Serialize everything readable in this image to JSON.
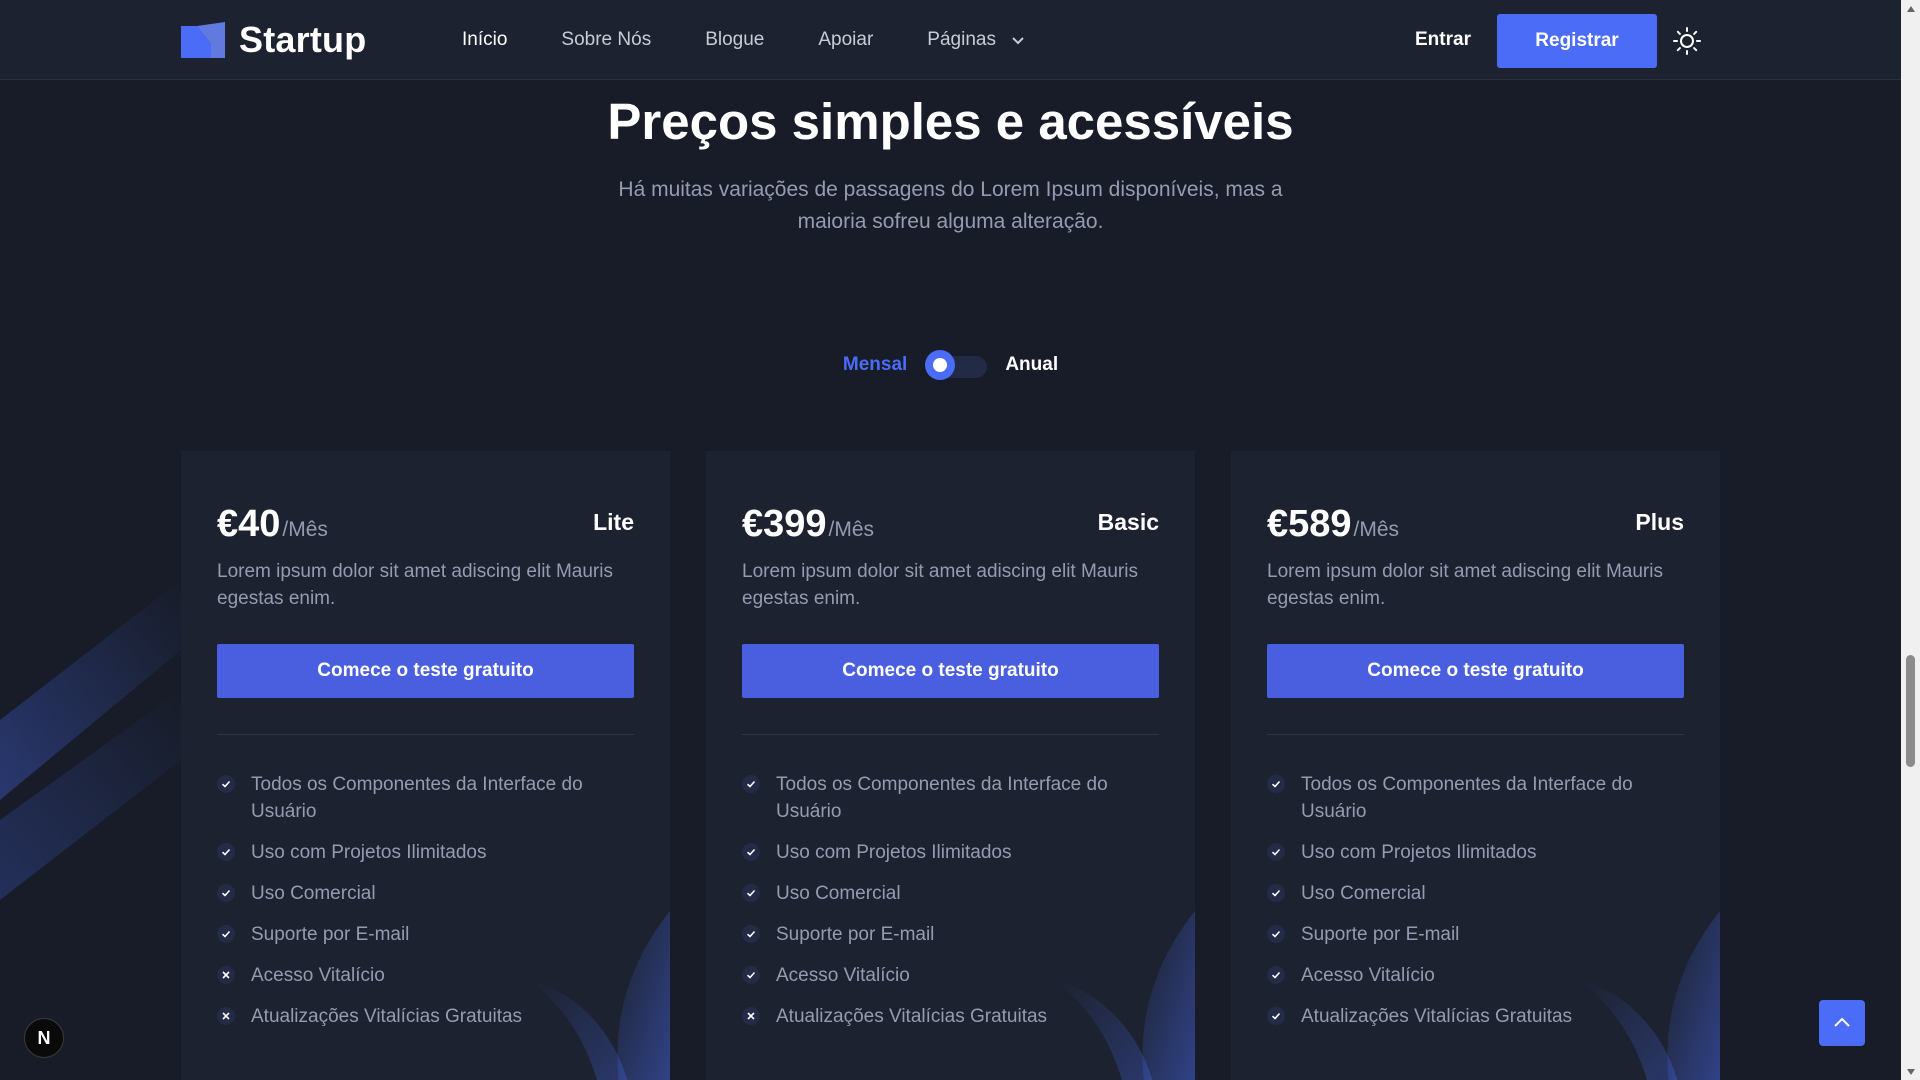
{
  "colors": {
    "accent": "#4a6cf7",
    "background": "#171c28",
    "card": "#1d2230",
    "muted": "#959cb1"
  },
  "header": {
    "logo_text": "Startup",
    "nav": [
      {
        "label": "Início",
        "active": true
      },
      {
        "label": "Sobre Nós"
      },
      {
        "label": "Blogue"
      },
      {
        "label": "Apoiar"
      },
      {
        "label": "Páginas",
        "icon": "chevron-down-icon"
      }
    ],
    "signin_label": "Entrar",
    "register_label": "Registrar",
    "theme_icon": "sun-icon"
  },
  "section": {
    "title": "Preços simples e acessíveis",
    "subtitle": "Há muitas variações de passagens do Lorem Ipsum disponíveis, mas a maioria sofreu alguma alteração."
  },
  "billing": {
    "monthly_label": "Mensal",
    "yearly_label": "Anual",
    "selected": "monthly"
  },
  "plans": [
    {
      "price": "€40",
      "period": "/Mês",
      "name": "Lite",
      "description": "Lorem ipsum dolor sit amet adiscing elit Mauris egestas enim.",
      "cta": "Comece o teste gratuito",
      "features": [
        {
          "text": "Todos os Componentes da Interface do Usuário",
          "included": true
        },
        {
          "text": "Uso com Projetos Ilimitados",
          "included": true
        },
        {
          "text": "Uso Comercial",
          "included": true
        },
        {
          "text": "Suporte por E-mail",
          "included": true
        },
        {
          "text": "Acesso Vitalício",
          "included": false
        },
        {
          "text": "Atualizações Vitalícias Gratuitas",
          "included": false
        }
      ]
    },
    {
      "price": "€399",
      "period": "/Mês",
      "name": "Basic",
      "description": "Lorem ipsum dolor sit amet adiscing elit Mauris egestas enim.",
      "cta": "Comece o teste gratuito",
      "features": [
        {
          "text": "Todos os Componentes da Interface do Usuário",
          "included": true
        },
        {
          "text": "Uso com Projetos Ilimitados",
          "included": true
        },
        {
          "text": "Uso Comercial",
          "included": true
        },
        {
          "text": "Suporte por E-mail",
          "included": true
        },
        {
          "text": "Acesso Vitalício",
          "included": true
        },
        {
          "text": "Atualizações Vitalícias Gratuitas",
          "included": false
        }
      ]
    },
    {
      "price": "€589",
      "period": "/Mês",
      "name": "Plus",
      "description": "Lorem ipsum dolor sit amet adiscing elit Mauris egestas enim.",
      "cta": "Comece o teste gratuito",
      "features": [
        {
          "text": "Todos os Componentes da Interface do Usuário",
          "included": true
        },
        {
          "text": "Uso com Projetos Ilimitados",
          "included": true
        },
        {
          "text": "Uso Comercial",
          "included": true
        },
        {
          "text": "Suporte por E-mail",
          "included": true
        },
        {
          "text": "Acesso Vitalício",
          "included": true
        },
        {
          "text": "Atualizações Vitalícias Gratuitas",
          "included": true
        }
      ]
    }
  ],
  "floating": {
    "badge_letter": "N",
    "scroll_top_icon": "chevron-up-icon"
  }
}
